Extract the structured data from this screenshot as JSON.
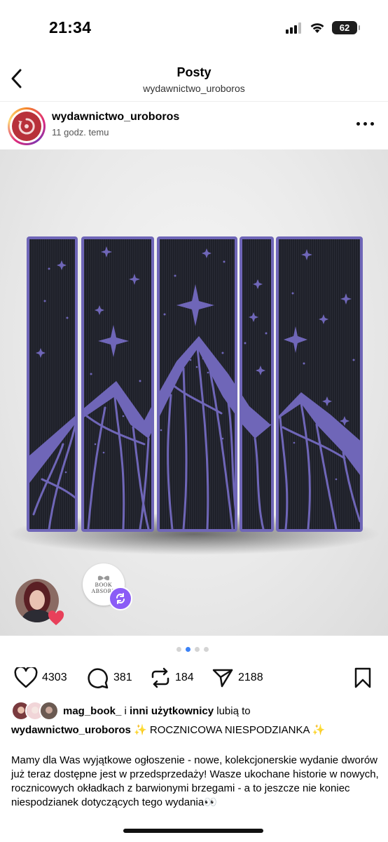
{
  "status_bar": {
    "time": "21:34",
    "battery": "62",
    "icons": [
      "signal-icon",
      "wifi-icon",
      "battery-icon"
    ]
  },
  "nav": {
    "title": "Posty",
    "subtitle": "wydawnictwo_uroboros",
    "back_icon": "chevron-left-icon"
  },
  "post": {
    "username": "wydawnictwo_uroboros",
    "time_ago": "11 godz. temu",
    "more_icon": "more-horizontal-icon",
    "photo_colors": {
      "edge": "#6f66b8",
      "spine": "#1d1f27",
      "background": "#ececec"
    },
    "collab_logo_text": [
      "BOOK",
      "ABSORB"
    ],
    "carousel": {
      "count": 4,
      "active_index": 1
    }
  },
  "actions": {
    "likes": "4303",
    "comments": "381",
    "reposts": "184",
    "shares": "2188",
    "icons": [
      "heart-icon",
      "comment-icon",
      "repost-icon",
      "send-icon",
      "bookmark-icon"
    ]
  },
  "liked_by": {
    "user": "mag_book_",
    "connector": "i",
    "others": "inni użytkownicy",
    "suffix": "lubią to"
  },
  "caption": {
    "username": "wydawnictwo_uroboros",
    "headline": "✨ ROCZNICOWA NIESPODZIANKA ✨",
    "body": "Mamy dla Was wyjątkowe ogłoszenie - nowe, kolekcjonerskie wydanie dworów już teraz dostępne jest w przedsprzedaży! Wasze ukochane historie w nowych, rocznicowych okładkach z barwionymi brzegami - a to jeszcze nie koniec niespodzianek dotyczących tego wydania👀"
  }
}
